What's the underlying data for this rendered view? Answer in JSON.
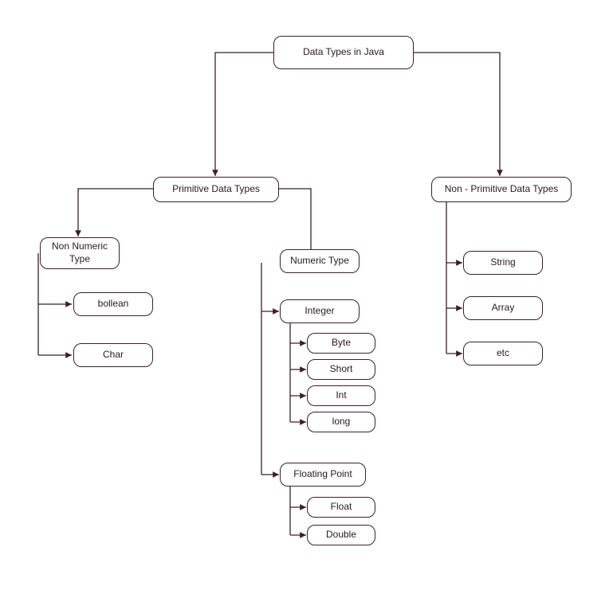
{
  "color": "#3d1f2a",
  "nodes": {
    "root": "Data Types in Java",
    "primitive": "Primitive Data Types",
    "nonprimitive": "Non - Primitive Data Types",
    "nonnumeric": "Non Numeric Type",
    "numeric": "Numeric Type",
    "boolean": "bollean",
    "char": "Char",
    "integer": "Integer",
    "byte": "Byte",
    "short": "Short",
    "int": "Int",
    "long": "long",
    "floating": "Floating Point",
    "float": "Float",
    "double": "Double",
    "string": "String",
    "array": "Array",
    "etc": "etc"
  }
}
